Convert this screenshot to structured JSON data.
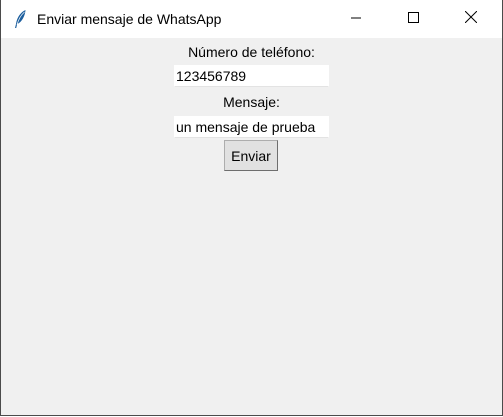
{
  "window": {
    "title": "Enviar mensaje de WhatsApp",
    "icon": "feather-icon",
    "controls": [
      "minimize-icon",
      "maximize-icon",
      "close-icon"
    ]
  },
  "form": {
    "phone_label": "Número de teléfono:",
    "phone_value": "123456789",
    "message_label": "Mensaje:",
    "message_value": "un mensaje de prueba",
    "send_label": "Enviar"
  }
}
